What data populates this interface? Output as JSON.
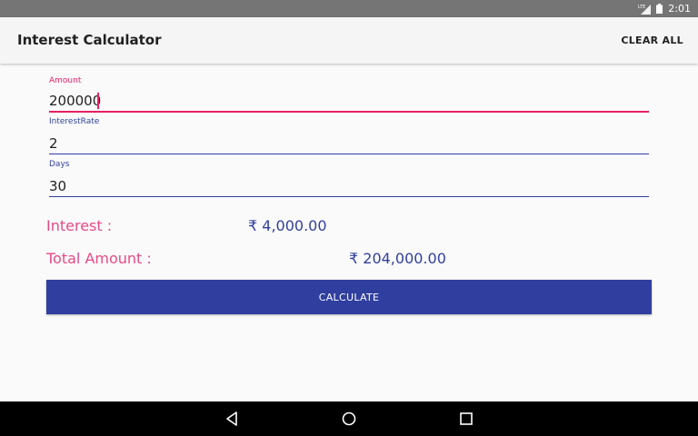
{
  "status_bar": {
    "network_label": "LTE",
    "time": "2:01"
  },
  "toolbar": {
    "title": "Interest Calculator",
    "clear_all_label": "CLEAR ALL"
  },
  "form": {
    "amount": {
      "label": "Amount",
      "value": "200000"
    },
    "rate": {
      "label": "InterestRate",
      "value": "2"
    },
    "days": {
      "label": "Days",
      "value": "30"
    }
  },
  "results": {
    "interest_label": "Interest :",
    "interest_value": "₹ 4,000.00",
    "total_label": "Total Amount :",
    "total_value": "₹ 204,000.00"
  },
  "calculate_label": "CALCULATE",
  "colors": {
    "accent": "#e91e63",
    "primary": "#303f9f"
  },
  "nav_icons": [
    "back-icon",
    "home-icon",
    "recents-icon"
  ]
}
